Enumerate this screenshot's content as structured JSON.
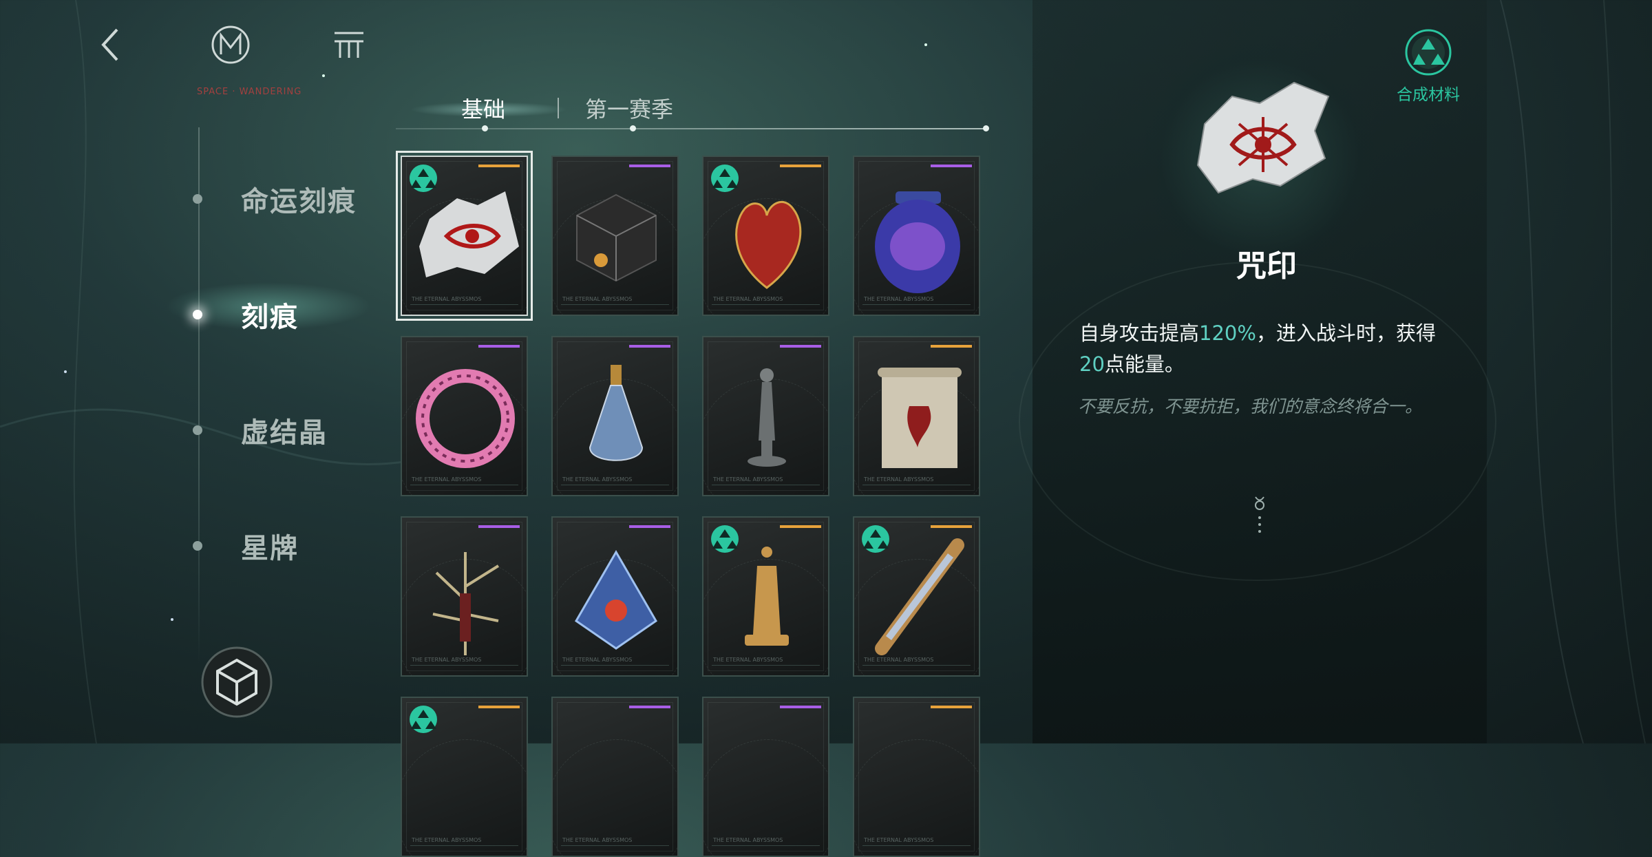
{
  "header": {
    "back_icon": "chevron-left-icon",
    "logo_icon": "m-logo-icon",
    "menu_icon": "menu-icon",
    "brand_sub": "SPACE · WANDERING"
  },
  "sidebar": {
    "items": [
      {
        "label": "命运刻痕",
        "active": false
      },
      {
        "label": "刻痕",
        "active": true
      },
      {
        "label": "虚结晶",
        "active": false
      },
      {
        "label": "星牌",
        "active": false
      }
    ]
  },
  "tabs": [
    {
      "label": "基础",
      "active": true
    },
    {
      "label": "第一赛季",
      "active": false
    }
  ],
  "grid": {
    "items": [
      {
        "name": "咒印",
        "rarity": "orange",
        "material": true,
        "icon": "cursed-paper-icon",
        "selected": true
      },
      {
        "name": "",
        "rarity": "purple",
        "material": false,
        "icon": "dark-cube-icon"
      },
      {
        "name": "",
        "rarity": "orange",
        "material": true,
        "icon": "heart-icon"
      },
      {
        "name": "",
        "rarity": "purple",
        "material": false,
        "icon": "galaxy-jar-icon"
      },
      {
        "name": "",
        "rarity": "purple",
        "material": false,
        "icon": "pink-ring-icon"
      },
      {
        "name": "",
        "rarity": "purple",
        "material": false,
        "icon": "potion-bottle-icon"
      },
      {
        "name": "",
        "rarity": "purple",
        "material": false,
        "icon": "statue-icon"
      },
      {
        "name": "",
        "rarity": "orange",
        "material": false,
        "icon": "scroll-icon"
      },
      {
        "name": "",
        "rarity": "purple",
        "material": false,
        "icon": "thorn-branch-icon"
      },
      {
        "name": "",
        "rarity": "purple",
        "material": false,
        "icon": "crystal-ship-icon"
      },
      {
        "name": "",
        "rarity": "orange",
        "material": true,
        "icon": "chess-queen-icon"
      },
      {
        "name": "",
        "rarity": "orange",
        "material": true,
        "icon": "ornate-rod-icon"
      },
      {
        "name": "",
        "rarity": "orange",
        "material": true,
        "icon": "item-icon"
      },
      {
        "name": "",
        "rarity": "purple",
        "material": false,
        "icon": "item-icon"
      },
      {
        "name": "",
        "rarity": "purple",
        "material": false,
        "icon": "item-icon"
      },
      {
        "name": "",
        "rarity": "orange",
        "material": false,
        "icon": "item-icon"
      }
    ],
    "card_footer": "THE ETERNAL ABYSSMOS"
  },
  "detail": {
    "name": "咒印",
    "desc_1": "自身攻击提高",
    "desc_hl_1": "120%",
    "desc_2": "，进入战斗时，获得",
    "desc_hl_2": "20",
    "desc_3": "点能量。",
    "flavor": "不要反抗，不要抗拒，我们的意念终将合一。",
    "synth_label": "合成材料"
  },
  "colors": {
    "accent": "#2bc6a0",
    "highlight": "#5fd0c2",
    "rarity_orange": "#e7a23b",
    "rarity_purple": "#a85ee6"
  }
}
